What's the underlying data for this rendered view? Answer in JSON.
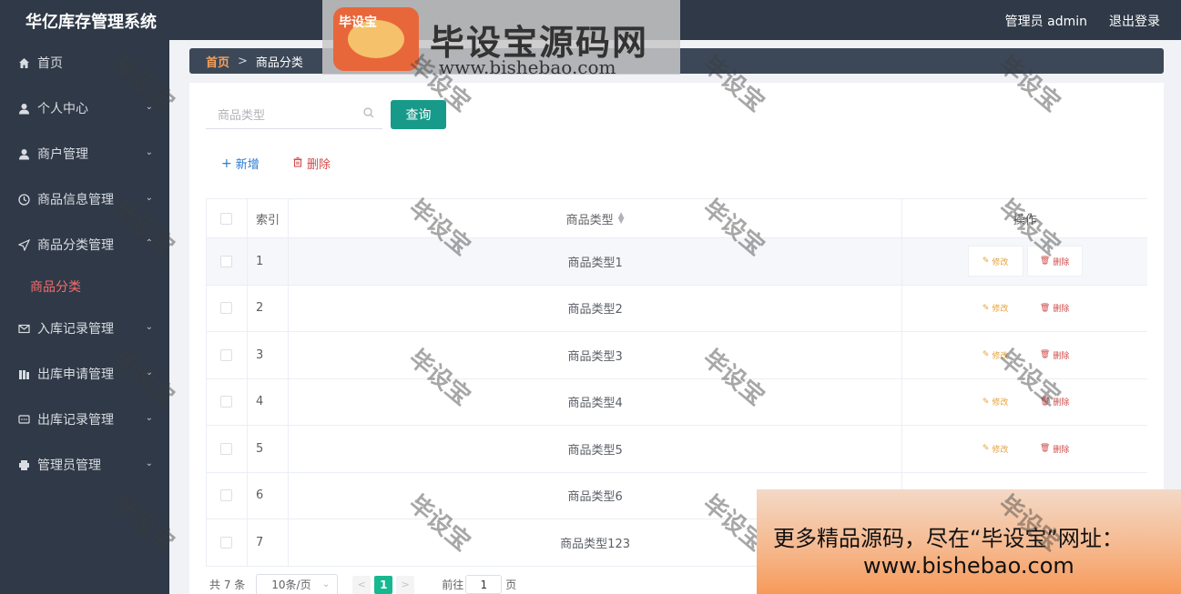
{
  "header": {
    "app_title": "华亿库存管理系统",
    "user": "管理员 admin",
    "logout": "退出登录"
  },
  "watermark_banner": {
    "logo_text": "毕设宝",
    "site_name": "毕设宝源码网",
    "url": "www.bishebao.com"
  },
  "sidebar": {
    "items": [
      {
        "label": "首页",
        "icon": "home-icon"
      },
      {
        "label": "个人中心",
        "icon": "user-icon"
      },
      {
        "label": "商户管理",
        "icon": "user-icon"
      },
      {
        "label": "商品信息管理",
        "icon": "clock-icon"
      },
      {
        "label": "商品分类管理",
        "icon": "send-icon"
      },
      {
        "label": "入库记录管理",
        "icon": "mail-icon"
      },
      {
        "label": "出库申请管理",
        "icon": "bar-icon"
      },
      {
        "label": "出库记录管理",
        "icon": "chat-icon"
      },
      {
        "label": "管理员管理",
        "icon": "printer-icon"
      }
    ],
    "active_sub": "商品分类"
  },
  "breadcrumb": {
    "home": "首页",
    "separator": ">",
    "current": "商品分类"
  },
  "search": {
    "placeholder": "商品类型",
    "button": "查询"
  },
  "actions": {
    "add": "新增",
    "delete": "删除"
  },
  "table": {
    "headers": {
      "index": "索引",
      "type": "商品类型",
      "ops": "操作"
    },
    "rows": [
      {
        "index": "1",
        "type": "商品类型1"
      },
      {
        "index": "2",
        "type": "商品类型2"
      },
      {
        "index": "3",
        "type": "商品类型3"
      },
      {
        "index": "4",
        "type": "商品类型4"
      },
      {
        "index": "5",
        "type": "商品类型5"
      },
      {
        "index": "6",
        "type": "商品类型6"
      },
      {
        "index": "7",
        "type": "商品类型123"
      }
    ],
    "edit_label": "修改",
    "delete_label": "删除"
  },
  "pagination": {
    "total": "共 7 条",
    "page_size": "10条/页",
    "current_page": "1",
    "goto_prefix": "前往",
    "goto_value": "1",
    "goto_suffix": "页"
  },
  "watermark_text": "毕设宝",
  "ad": {
    "line1": "更多精品源码，尽在“毕设宝”网址：",
    "line2": "www.bishebao.com"
  },
  "colors": {
    "sidebar_bg": "#2f3947",
    "accent": "#179a8a",
    "active_sub": "#f56c6c",
    "breadcrumb_home": "#f4a15b"
  }
}
